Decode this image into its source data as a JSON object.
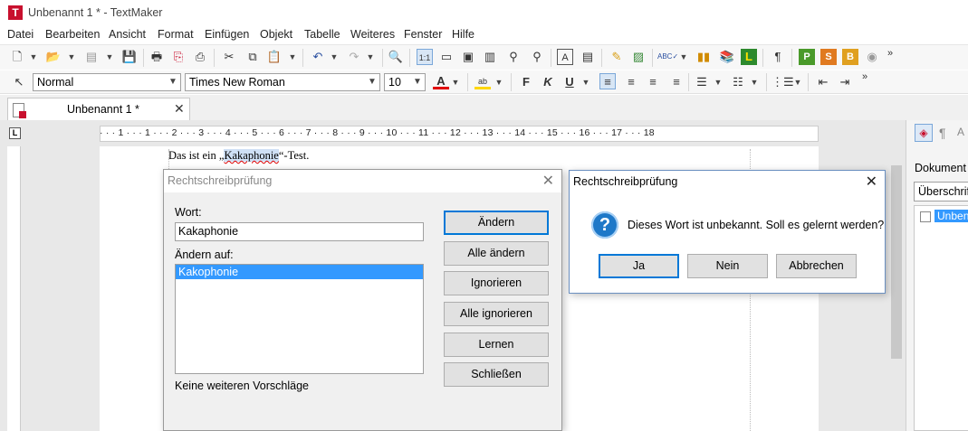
{
  "window": {
    "title": "Unbenannt 1 * - TextMaker",
    "app_icon_letter": "T"
  },
  "menu": [
    "Datei",
    "Bearbeiten",
    "Ansicht",
    "Format",
    "Einfügen",
    "Objekt",
    "Tabelle",
    "Weiteres",
    "Fenster",
    "Hilfe"
  ],
  "format_bar": {
    "style": "Normal",
    "font": "Times New Roman",
    "size": "10"
  },
  "tab": {
    "label": "Unbenannt 1 *"
  },
  "ruler": {
    "numbers": "· · · 1 · · · 1 · · · 2 · · · 3 · · · 4 · · · 5 · · · 6 · · · 7 · · · 8 · · · 9 · · · 10 · · · 11 · · · 12 · · · 13 · · · 14 · · · 15 · · · 16 · · · 17 · · · 18",
    "corner": "L"
  },
  "document": {
    "before": "Das ist ein „",
    "word": "Kakaphonie",
    "after": "“-Test."
  },
  "spell_dialog": {
    "title": "Rechtschreibprüfung",
    "word_label": "Wort:",
    "word_value": "Kakaphonie",
    "change_to_label": "Ändern auf:",
    "suggestions": [
      "Kakophonie"
    ],
    "no_more": "Keine weiteren Vorschläge",
    "buttons": {
      "change": "Ändern",
      "change_all": "Alle ändern",
      "ignore": "Ignorieren",
      "ignore_all": "Alle ignorieren",
      "learn": "Lernen",
      "close": "Schließen"
    }
  },
  "msg_dialog": {
    "title": "Rechtschreibprüfung",
    "message": "Dieses Wort ist unbekannt. Soll es gelernt werden?",
    "buttons": {
      "yes": "Ja",
      "no": "Nein",
      "cancel": "Abbrechen"
    }
  },
  "sidebar": {
    "label": "Dokument",
    "combo": "Überschrif",
    "tree_item": "Unben"
  },
  "colors": {
    "accent": "#0078d7",
    "app_red": "#c8102e",
    "selection": "#3399ff"
  }
}
